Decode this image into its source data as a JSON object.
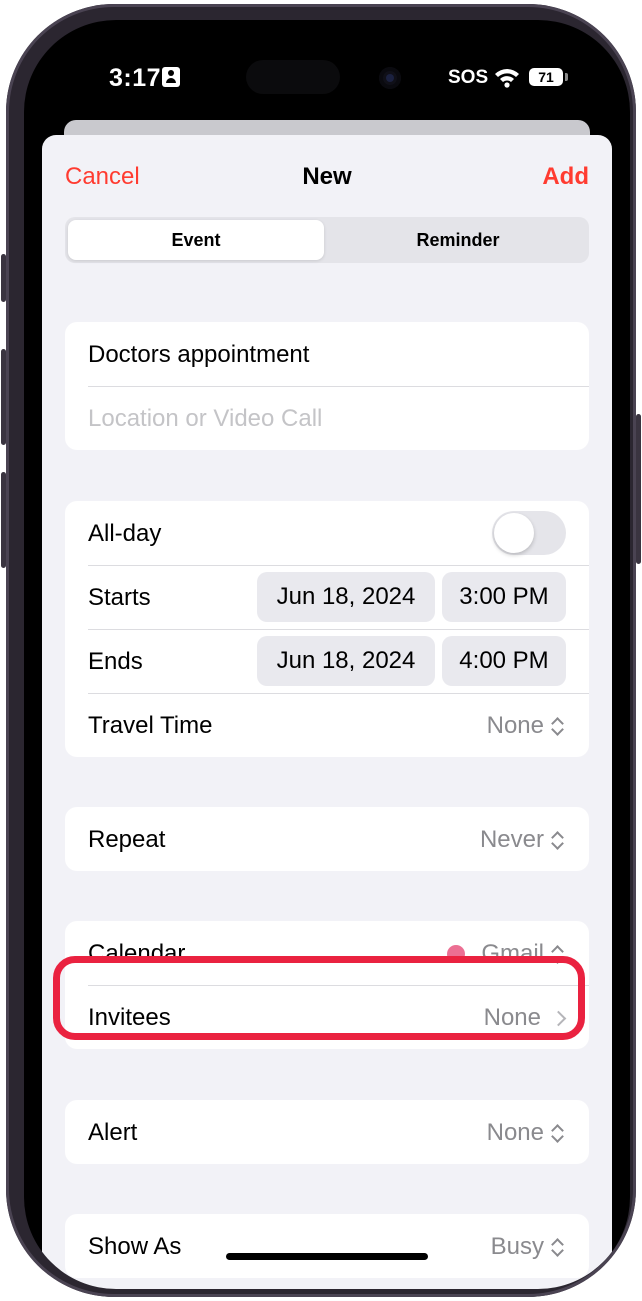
{
  "status_bar": {
    "time": "3:17",
    "carrier": "SOS",
    "battery": "71"
  },
  "nav": {
    "cancel": "Cancel",
    "title": "New",
    "add": "Add"
  },
  "segments": {
    "event": "Event",
    "reminder": "Reminder",
    "selected": "Event"
  },
  "event": {
    "title": "Doctors appointment",
    "location_placeholder": "Location or Video Call"
  },
  "all_day": {
    "label": "All-day",
    "on": false
  },
  "starts": {
    "label": "Starts",
    "date": "Jun 18, 2024",
    "time": "3:00 PM"
  },
  "ends": {
    "label": "Ends",
    "date": "Jun 18, 2024",
    "time": "4:00 PM"
  },
  "travel_time": {
    "label": "Travel Time",
    "value": "None"
  },
  "repeat": {
    "label": "Repeat",
    "value": "Never"
  },
  "calendar": {
    "label": "Calendar",
    "value": "Gmail",
    "color": "#ec6f93"
  },
  "invitees": {
    "label": "Invitees",
    "value": "None"
  },
  "alert": {
    "label": "Alert",
    "value": "None"
  },
  "show_as": {
    "label": "Show As",
    "value": "Busy"
  },
  "colors": {
    "accent": "#ff3b30",
    "highlight": "#ea2240"
  }
}
